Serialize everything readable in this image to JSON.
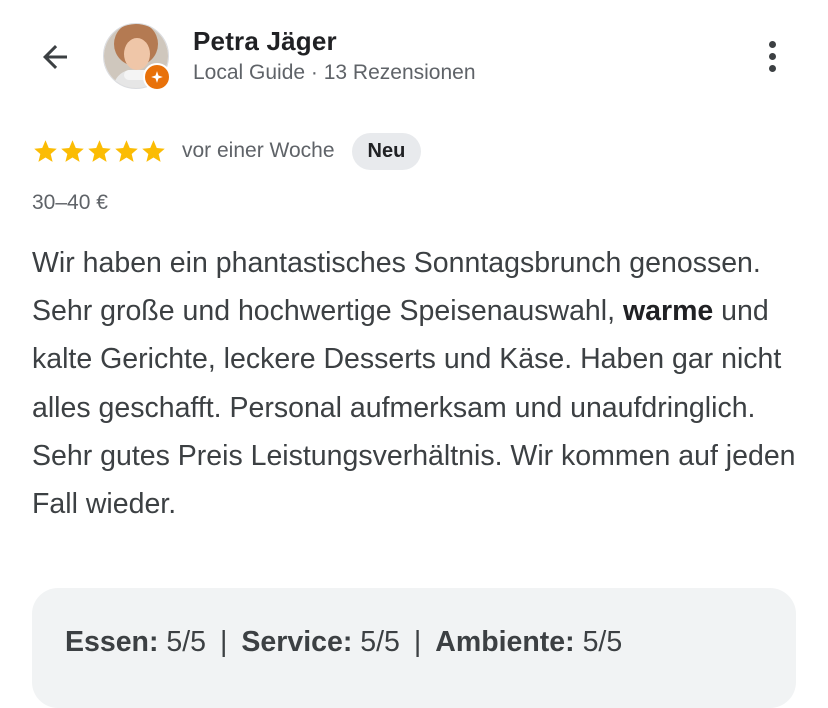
{
  "header": {
    "back_icon": "arrow-left-icon",
    "author_name": "Petra Jäger",
    "author_meta": "Local Guide · 13 Rezensionen",
    "more_icon": "more-vert-icon"
  },
  "review": {
    "stars": 5,
    "star_color": "#fbbc04",
    "time_ago": "vor einer Woche",
    "badge": "Neu",
    "price": "30–40 €",
    "text_part1": "Wir haben ein phantastisches Sonntagsbrunch genossen. Sehr große und hochwertige Speisenauswahl, ",
    "text_bold": "warme",
    "text_part2": " und kalte Gerichte, leckere Desserts und Käse. Haben gar nicht alles geschafft. Personal aufmerksam und unaufdringlich. Sehr gutes Preis Leistungsverhältnis. Wir kommen auf jeden Fall wieder."
  },
  "ratings": {
    "food_label": "Essen:",
    "food_value": "5/5",
    "service_label": "Service:",
    "service_value": "5/5",
    "ambience_label": "Ambiente:",
    "ambience_value": "5/5",
    "separator": "|"
  },
  "colors": {
    "badge_orange": "#e8710a",
    "badge_bg": "#e8eaed",
    "ratings_bg": "#f1f3f4"
  }
}
